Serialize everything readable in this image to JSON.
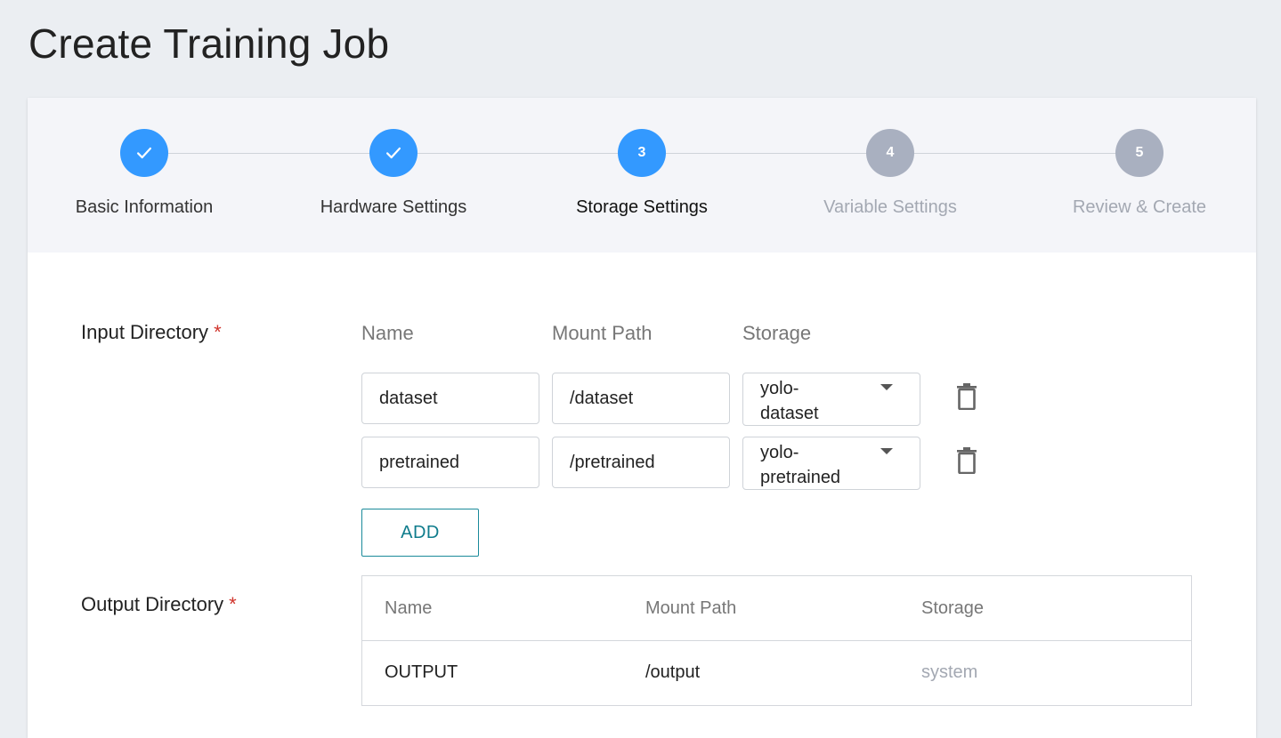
{
  "page": {
    "title": "Create Training Job"
  },
  "stepper": {
    "steps": [
      {
        "number": "1",
        "label": "Basic Information",
        "state": "done"
      },
      {
        "number": "2",
        "label": "Hardware Settings",
        "state": "done"
      },
      {
        "number": "3",
        "label": "Storage Settings",
        "state": "current"
      },
      {
        "number": "4",
        "label": "Variable Settings",
        "state": "pending"
      },
      {
        "number": "5",
        "label": "Review & Create",
        "state": "pending"
      }
    ],
    "colors": {
      "active": "#3399ff",
      "inactive": "#a9b0c0"
    }
  },
  "input_directory": {
    "label": "Input Directory",
    "required_mark": "*",
    "columns": {
      "name": "Name",
      "mount_path": "Mount Path",
      "storage": "Storage"
    },
    "rows": [
      {
        "name": "dataset",
        "mount_path": "/dataset",
        "storage": "yolo-dataset",
        "storage_line1": "yolo-",
        "storage_line2": "dataset"
      },
      {
        "name": "pretrained",
        "mount_path": "/pretrained",
        "storage": "yolo-pretrained",
        "storage_line1": "yolo-",
        "storage_line2": "pretrained"
      }
    ],
    "add_label": "ADD"
  },
  "output_directory": {
    "label": "Output Directory",
    "required_mark": "*",
    "columns": {
      "name": "Name",
      "mount_path": "Mount Path",
      "storage": "Storage"
    },
    "rows": [
      {
        "name": "OUTPUT",
        "mount_path": "/output",
        "storage": "system"
      }
    ]
  }
}
